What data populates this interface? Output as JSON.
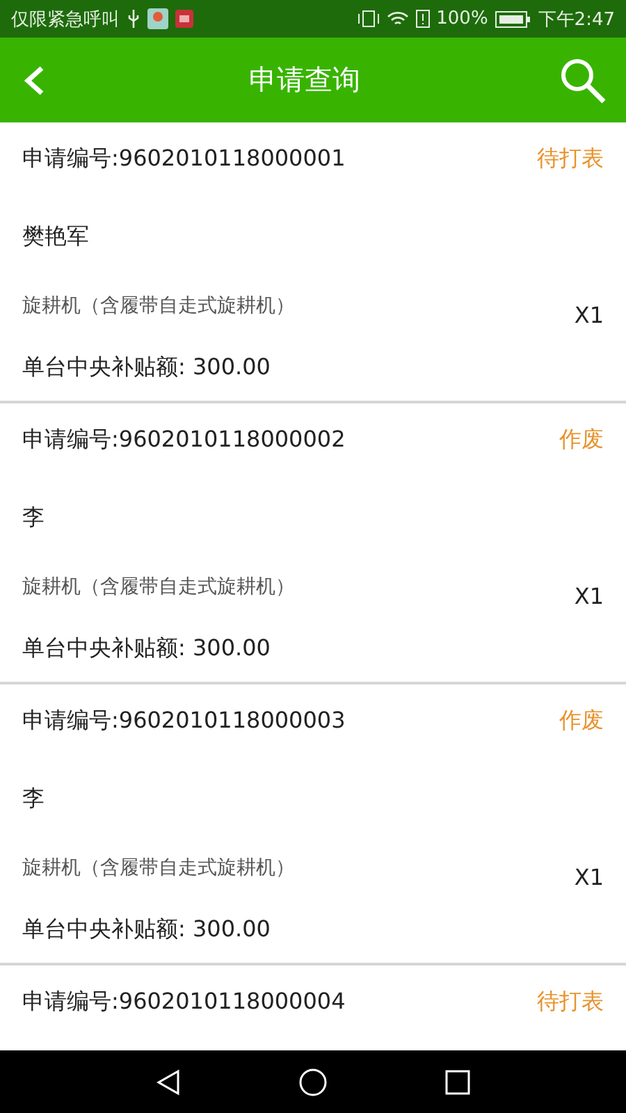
{
  "status_bar": {
    "carrier": "仅限紧急呼叫",
    "battery": "100%",
    "time": "下午2:47"
  },
  "header": {
    "title": "申请查询"
  },
  "applications": [
    {
      "number": "申请编号:9602010118000001",
      "status": "待打表",
      "applicant": "樊艳军",
      "product": "旋耕机（含履带自走式旋耕机）",
      "quantity": "X1",
      "subsidy": "单台中央补贴额: 300.00"
    },
    {
      "number": "申请编号:9602010118000002",
      "status": "作废",
      "applicant": "李",
      "product": "旋耕机（含履带自走式旋耕机）",
      "quantity": "X1",
      "subsidy": "单台中央补贴额: 300.00"
    },
    {
      "number": "申请编号:9602010118000003",
      "status": "作废",
      "applicant": "李",
      "product": "旋耕机（含履带自走式旋耕机）",
      "quantity": "X1",
      "subsidy": "单台中央补贴额: 300.00"
    },
    {
      "number": "申请编号:9602010118000004",
      "status": "待打表"
    }
  ]
}
